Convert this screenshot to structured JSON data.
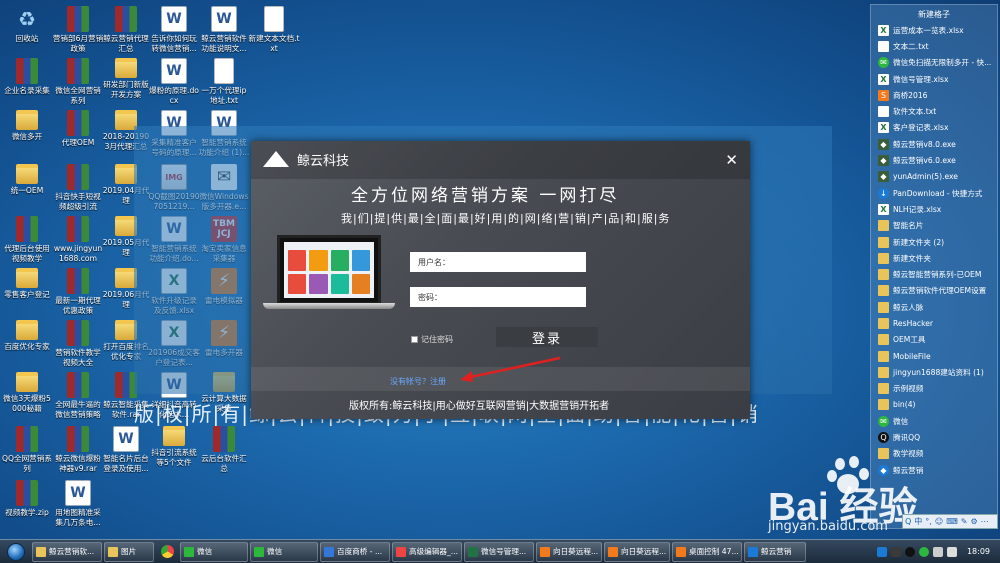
{
  "desktop": {
    "icons": [
      {
        "label": "回收站",
        "type": "recycle",
        "glyph": "♻"
      },
      {
        "label": "营销部6月营销政策",
        "type": "winrar",
        "glyph": ""
      },
      {
        "label": "鲸云营销代理汇总",
        "type": "winrar",
        "glyph": ""
      },
      {
        "label": "告诉你如何玩转微信营销...",
        "type": "word",
        "glyph": "W"
      },
      {
        "label": "鲸云营销软件功能说明文...",
        "type": "word",
        "glyph": "W"
      },
      {
        "label": "新建文本文档.txt",
        "type": "txt",
        "glyph": ""
      },
      {
        "label": "企业名录采集",
        "type": "winrar",
        "glyph": ""
      },
      {
        "label": "微信全网营销系列",
        "type": "winrar",
        "glyph": ""
      },
      {
        "label": "研发部门新版开发方案",
        "type": "folder",
        "glyph": ""
      },
      {
        "label": "爆粉的原理.docx",
        "type": "word",
        "glyph": "W"
      },
      {
        "label": "一万个代理ip地址.txt",
        "type": "txt",
        "glyph": ""
      },
      {
        "label": "微信多开",
        "type": "folder",
        "glyph": ""
      },
      {
        "label": "代理OEM",
        "type": "winrar",
        "glyph": ""
      },
      {
        "label": "2018-20190 3月代理汇总",
        "type": "folder",
        "glyph": ""
      },
      {
        "label": "采集精准客户号码的原理...",
        "type": "word",
        "glyph": "W"
      },
      {
        "label": "智能营销系统功能介绍 (1)...",
        "type": "word",
        "glyph": "W"
      },
      {
        "label": "统一OEM",
        "type": "folder",
        "glyph": ""
      },
      {
        "label": "抖音快手短视频超级引流",
        "type": "winrar",
        "glyph": ""
      },
      {
        "label": "2019.04月代理",
        "type": "folder",
        "glyph": ""
      },
      {
        "label": "QQ截图201907051219...",
        "type": "image",
        "glyph": "IMG"
      },
      {
        "label": "微信Windows版多开器.e...",
        "type": "wechat",
        "glyph": "✉"
      },
      {
        "label": "代理后台使用视频教学",
        "type": "winrar",
        "glyph": ""
      },
      {
        "label": "www.jingyun1688.com",
        "type": "winrar",
        "glyph": ""
      },
      {
        "label": "2019.05月代理",
        "type": "folder",
        "glyph": ""
      },
      {
        "label": "智能营销系统功能介绍.do...",
        "type": "word",
        "glyph": "W"
      },
      {
        "label": "淘宝卖家信息采集器",
        "type": "red",
        "glyph": "TBM JCJ"
      },
      {
        "label": "零售客户登记",
        "type": "folder",
        "glyph": ""
      },
      {
        "label": "最新一期代理优惠政策",
        "type": "winrar",
        "glyph": ""
      },
      {
        "label": "2019.06月代理",
        "type": "folder",
        "glyph": ""
      },
      {
        "label": "软件升级记录及反馈.xlsx",
        "type": "excel",
        "glyph": "X"
      },
      {
        "label": "雷电模拟器",
        "type": "orange",
        "glyph": "⚡"
      },
      {
        "label": "百度优化专家",
        "type": "folder",
        "glyph": ""
      },
      {
        "label": "营销软件教学视频大全",
        "type": "winrar",
        "glyph": ""
      },
      {
        "label": "打开百度排名优化专家",
        "type": "folder",
        "glyph": ""
      },
      {
        "label": "201906成交客户登记表...",
        "type": "excel",
        "glyph": "X"
      },
      {
        "label": "雷电多开器",
        "type": "orange",
        "glyph": "⚡"
      },
      {
        "label": "微信3天爆粉5000秘籍",
        "type": "folder",
        "glyph": ""
      },
      {
        "label": "全网最牛逼的微信营销策略",
        "type": "winrar",
        "glyph": ""
      },
      {
        "label": "鲸云智能采集软件.rar",
        "type": "winrar",
        "glyph": ""
      },
      {
        "label": "详细抖音高转化话术...",
        "type": "word",
        "glyph": "W"
      },
      {
        "label": "云计算大数据采集",
        "type": "folder",
        "glyph": ""
      },
      {
        "label": "QQ全网营销系列",
        "type": "winrar",
        "glyph": ""
      },
      {
        "label": "鲸云微信爆粉神器v9.rar",
        "type": "winrar",
        "glyph": ""
      },
      {
        "label": "智能名片后台登录及使用...",
        "type": "word",
        "glyph": "W"
      },
      {
        "label": "抖音引流系统等5个文件",
        "type": "folder",
        "glyph": ""
      },
      {
        "label": "云后台软件汇总",
        "type": "winrar",
        "glyph": ""
      },
      {
        "label": "视频教学.zip",
        "type": "winrar",
        "glyph": ""
      },
      {
        "label": "用地图精准采集几万条电...",
        "type": "word",
        "glyph": "W"
      }
    ]
  },
  "background": {
    "footer_text": "版|权|所|有|鲸|云|科|技|致|力|于|互|联|网|全|面|助|智|能|化|营|销"
  },
  "dialog": {
    "brand": "鲸云科技",
    "close": "✕",
    "headline": "全方位网络营销方案  一网打尽",
    "subline": "我|们|提|供|最|全|面|最|好|用|的|网|络|营|销|产|品|和|服|务",
    "username_label": "用户名：",
    "password_label": "密码：",
    "remember_label": "记住密码",
    "login_button": "登录",
    "register_link": "没有帐号？注册",
    "copyright": "版权所有:鲸云科技|用心做好互联网营销|大数据营销开拓者",
    "laptop_tile_colors": [
      "#e74c3c",
      "#f39c12",
      "#27ae60",
      "#3498db",
      "#e74c3c",
      "#9b59b6",
      "#1abc9c",
      "#e67e22"
    ],
    "arrow_color": "#e02020"
  },
  "panel": {
    "title": "新建格子",
    "items": [
      {
        "label": "运营成本一览表.xlsx",
        "type": "excel",
        "glyph": "X"
      },
      {
        "label": "文本二.txt",
        "type": "txt",
        "glyph": ""
      },
      {
        "label": "微信免扫描无限制多开 - 快...",
        "type": "wechat",
        "glyph": "✉"
      },
      {
        "label": "微信号管理.xlsx",
        "type": "excel",
        "glyph": "X"
      },
      {
        "label": "商桥2016",
        "type": "app",
        "glyph": "S"
      },
      {
        "label": "软件文本.txt",
        "type": "txt",
        "glyph": ""
      },
      {
        "label": "客户登记表.xlsx",
        "type": "excel",
        "glyph": "X"
      },
      {
        "label": "鲸云营销v8.0.exe",
        "type": "exe",
        "glyph": "◆"
      },
      {
        "label": "鲸云营销v6.0.exe",
        "type": "exe",
        "glyph": "◆"
      },
      {
        "label": "yunAdmin(5).exe",
        "type": "exe",
        "glyph": "◆"
      },
      {
        "label": "PanDownload - 快捷方式",
        "type": "blue",
        "glyph": "↓"
      },
      {
        "label": "NLH记录.xlsx",
        "type": "excel",
        "glyph": "X"
      },
      {
        "label": "智能名片",
        "type": "folder",
        "glyph": ""
      },
      {
        "label": "新建文件夹 (2)",
        "type": "folder",
        "glyph": ""
      },
      {
        "label": "新建文件夹",
        "type": "folder",
        "glyph": ""
      },
      {
        "label": "鲸云智能营销系列-已OEM",
        "type": "folder",
        "glyph": ""
      },
      {
        "label": "鲸云营销软件代理OEM设置",
        "type": "folder",
        "glyph": ""
      },
      {
        "label": "鲸云人脉",
        "type": "folder",
        "glyph": ""
      },
      {
        "label": "ResHacker",
        "type": "folder",
        "glyph": ""
      },
      {
        "label": "OEM工具",
        "type": "folder",
        "glyph": ""
      },
      {
        "label": "MobileFile",
        "type": "folder",
        "glyph": ""
      },
      {
        "label": "jingyun1688建站资料 (1)",
        "type": "folder",
        "glyph": ""
      },
      {
        "label": "示例视频",
        "type": "folder",
        "glyph": ""
      },
      {
        "label": "bin(4)",
        "type": "folder",
        "glyph": ""
      },
      {
        "label": "微信",
        "type": "wechat",
        "glyph": "✉"
      },
      {
        "label": "腾讯QQ",
        "type": "qq",
        "glyph": "Q"
      },
      {
        "label": "教学视频",
        "type": "folder",
        "glyph": ""
      },
      {
        "label": "鲸云营销",
        "type": "blue",
        "glyph": "◆"
      }
    ]
  },
  "watermark": {
    "logo_text": "Bai  经验",
    "url": "jingyan.baidu.com"
  },
  "ime": {
    "items": [
      "Q",
      "中",
      "°,",
      "☺",
      "⌨",
      "✎",
      "⚙",
      "⋯"
    ]
  },
  "taskbar": {
    "buttons": [
      {
        "label": "鲸云营销软...",
        "color": "#e8c45a",
        "width": 70
      },
      {
        "label": "图片",
        "color": "#e8c45a",
        "width": 50
      },
      {
        "label": "",
        "icon": "chrome",
        "color": "#e44",
        "width": 22
      },
      {
        "label": "微信",
        "color": "#2db83d",
        "width": 68
      },
      {
        "label": "微信",
        "color": "#2db83d",
        "width": 68
      },
      {
        "label": "百度商桥 - ...",
        "color": "#3477d8",
        "width": 70
      },
      {
        "label": "高级编辑器_...",
        "color": "#e44",
        "width": 70
      },
      {
        "label": "微信号管理...",
        "color": "#217346",
        "width": 70
      },
      {
        "label": "向日葵远程...",
        "color": "#f27a1a",
        "width": 66
      },
      {
        "label": "向日葵远程...",
        "color": "#f27a1a",
        "width": 66
      },
      {
        "label": "桌面控制 47...",
        "color": "#f27a1a",
        "width": 70
      },
      {
        "label": "鲸云营销",
        "color": "#1b7ad6",
        "width": 62
      }
    ],
    "clock": "18:09"
  }
}
